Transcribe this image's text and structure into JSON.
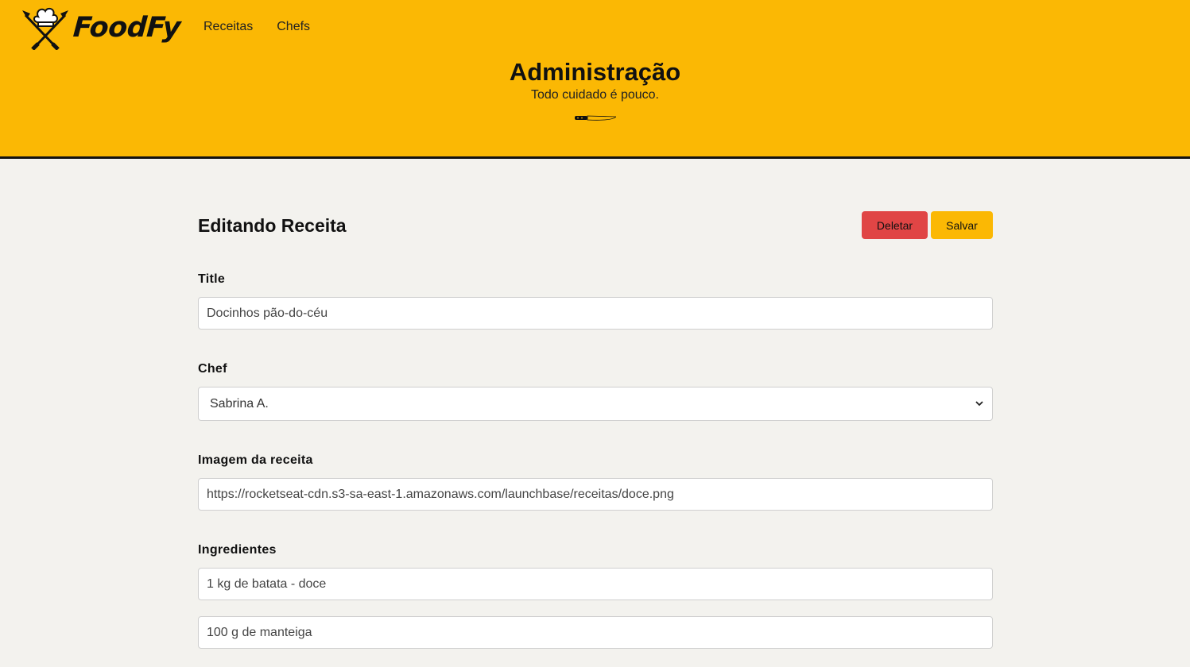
{
  "brand": {
    "name": "FoodFy"
  },
  "nav": {
    "items": [
      {
        "label": "Receitas"
      },
      {
        "label": "Chefs"
      }
    ]
  },
  "hero": {
    "title": "Administração",
    "subtitle": "Todo cuidado é pouco."
  },
  "form": {
    "heading": "Editando Receita",
    "delete_label": "Deletar",
    "save_label": "Salvar",
    "title": {
      "label": "Title",
      "value": "Docinhos pão-do-céu"
    },
    "chef": {
      "label": "Chef",
      "selected": "Sabrina A."
    },
    "image": {
      "label": "Imagem da receita",
      "value": "https://rocketseat-cdn.s3-sa-east-1.amazonaws.com/launchbase/receitas/doce.png"
    },
    "ingredients": {
      "label": "Ingredientes",
      "items": [
        "1 kg de batata - doce",
        "100 g de manteiga"
      ]
    }
  },
  "colors": {
    "accent": "#fbb804",
    "danger": "#e04545",
    "background": "#f3f2ee"
  }
}
